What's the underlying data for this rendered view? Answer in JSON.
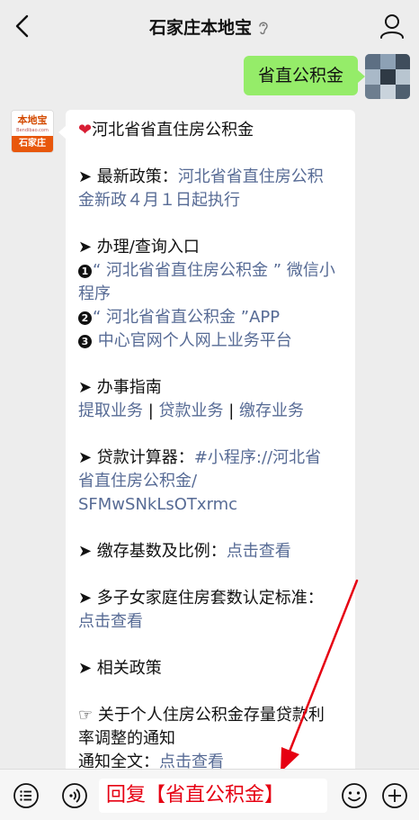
{
  "header": {
    "title": "石家庄本地宝",
    "back_icon": "chevron-left-icon",
    "ear_icon": "ear-icon",
    "profile_icon": "person-icon"
  },
  "my_message": {
    "text": "省直公积金"
  },
  "bot": {
    "logo_text": "本地宝",
    "logo_sub": "Bendibao.com",
    "logo_city": "石家庄"
  },
  "message": {
    "heading": "河北省省直住房公积金",
    "latest": {
      "label": "➤ 最新政策：",
      "link_line1": "河北省省直住房公积",
      "link_line2": "金新政４月１日起执行"
    },
    "entry": {
      "label": "➤ 办理/查询入口",
      "item1_num": "1",
      "item1_line1": "“ 河北省省直住房公积金 ” 微信小",
      "item1_line2": "程序",
      "item2_num": "2",
      "item2_text": "“ 河北省省直公积金 ”APP",
      "item3_num": "3",
      "item3_text": "中心官网个人网上业务平台"
    },
    "guide": {
      "label": "➤ 办事指南",
      "link1": "提取业务",
      "sep1": " | ",
      "link2": "贷款业务",
      "sep2": " | ",
      "link3": "缴存业务"
    },
    "calculator": {
      "label": "➤ 贷款计算器：",
      "link_line1": "#小程序://河北省",
      "link_line2": "省直住房公积金/",
      "link_line3": "SFMwSNkLsOTxrmc"
    },
    "base": {
      "label": "➤ 缴存基数及比例：",
      "link": "点击查看"
    },
    "multi_child": {
      "label": "➤ 多子女家庭住房套数认定标准：",
      "link": "点击查看"
    },
    "related": {
      "label": "➤ 相关政策"
    },
    "notice": {
      "line1": "☞ 关于个人住房公积金存量贷款利",
      "line2": "率调整的通知",
      "full_label": "通知全文：",
      "link": "点击查看"
    }
  },
  "bottom": {
    "reply_text": "回复【省直公积金】",
    "menu_icon": "menu-icon",
    "voice_icon": "voice-icon",
    "emoji_icon": "emoji-icon",
    "plus_icon": "plus-icon"
  },
  "colors": {
    "link": "#576b95",
    "my_bubble": "#95ec69",
    "reply_text": "#e60012",
    "annotation": "#e60012"
  }
}
